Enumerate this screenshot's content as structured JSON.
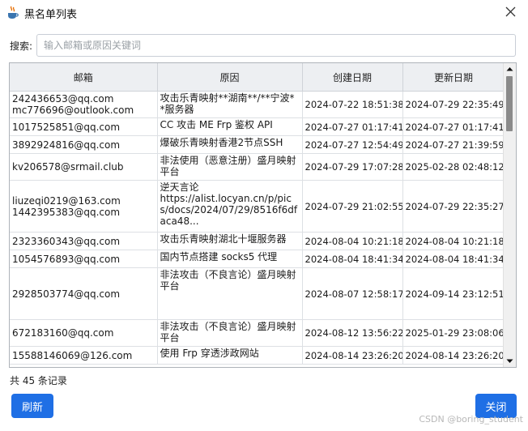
{
  "window": {
    "title": "黑名单列表"
  },
  "search": {
    "label": "搜索:",
    "placeholder": "输入邮箱或原因关键词",
    "value": ""
  },
  "table": {
    "headers": [
      "邮箱",
      "原因",
      "创建日期",
      "更新日期"
    ],
    "rows": [
      {
        "emails": [
          "242436653@qq.com",
          "mc776696@outlook.com"
        ],
        "reason": "攻击乐青映射**湖南**/**宁波**服务器",
        "created": "2024-07-22 18:51:38",
        "updated": "2024-07-29 22:35:49"
      },
      {
        "emails": [
          "1017525851@qq.com"
        ],
        "reason": "CC 攻击 ME Frp 鉴权 API",
        "created": "2024-07-27 01:17:41",
        "updated": "2024-07-27 01:17:41"
      },
      {
        "emails": [
          "3892924816@qq.com"
        ],
        "reason": "爆破乐青映射香港2节点SSH",
        "created": "2024-07-27 12:54:49",
        "updated": "2024-07-27 21:39:59"
      },
      {
        "emails": [
          "kv206578@srmail.club"
        ],
        "reason": "非法使用（恶意注册）盛月映射平台",
        "created": "2024-07-29 17:07:28",
        "updated": "2025-02-28 02:48:12"
      },
      {
        "emails": [
          "liuzeqi0219@163.com",
          "1442395383@qq.com"
        ],
        "reason": "逆天言论\nhttps://alist.locyan.cn/p/pics/docs/2024/07/29/8516f6dfaca48...",
        "created": "2024-07-29 21:02:55",
        "updated": "2024-07-29 22:35:27"
      },
      {
        "emails": [
          "2323360343@qq.com"
        ],
        "reason": "攻击乐青映射湖北十堰服务器",
        "created": "2024-08-04 10:21:18",
        "updated": "2024-08-04 10:21:18"
      },
      {
        "emails": [
          "1054576893@qq.com"
        ],
        "reason": "国内节点搭建 socks5 代理",
        "created": "2024-08-04 18:41:34",
        "updated": "2024-08-04 18:41:34"
      },
      {
        "emails": [
          "2928503774@qq.com"
        ],
        "reason": "非法攻击（不良言论）盛月映射平台",
        "created": "2024-08-07 12:58:17",
        "updated": "2024-09-14 23:12:51"
      },
      {
        "emails": [
          "672183160@qq.com"
        ],
        "reason": "非法攻击（不良言论）盛月映射平台",
        "created": "2024-08-12 13:56:22",
        "updated": "2025-01-29 23:08:06"
      },
      {
        "emails": [
          "15588146069@126.com"
        ],
        "reason": "使用 Frp 穿透涉政网站",
        "created": "2024-08-14 23:26:20",
        "updated": "2024-08-14 23:26:20"
      }
    ]
  },
  "footer": {
    "count_text": "共 45 条记录",
    "refresh_label": "刷新",
    "close_label": "关闭"
  },
  "watermark": "CSDN @boring_student",
  "colors": {
    "accent": "#1f6fe5",
    "header_bg": "#edeff2"
  }
}
